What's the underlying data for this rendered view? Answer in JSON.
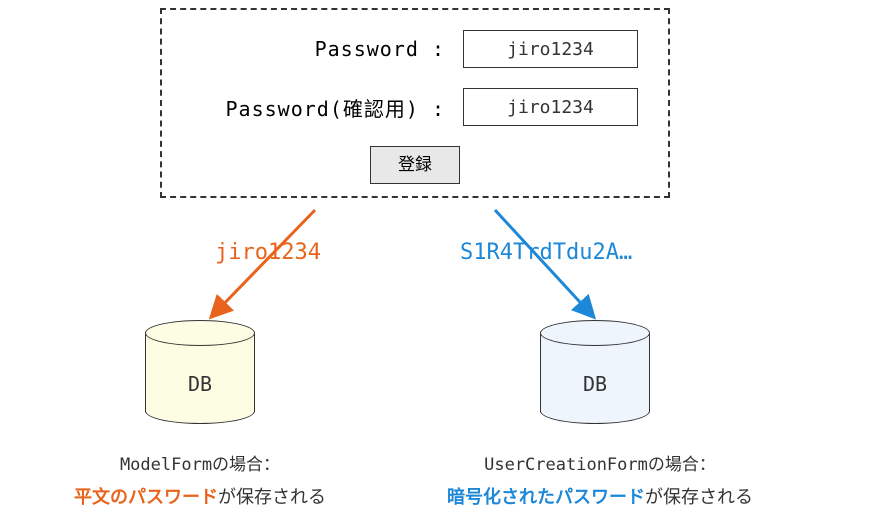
{
  "form": {
    "password_label": "Password :",
    "password_confirm_label": "Password(確認用) :",
    "password_value": "jiro1234",
    "password_confirm_value": "jiro1234",
    "submit_label": "登録"
  },
  "arrows": {
    "left_text": "jiro1234",
    "right_text": "S1R4TrdTdu2A…"
  },
  "db": {
    "left_label": "DB",
    "right_label": "DB"
  },
  "captions": {
    "left_title": "ModelFormの場合：",
    "left_highlight": "平文のパスワード",
    "left_rest": "が保存される",
    "right_title": "UserCreationFormの場合：",
    "right_highlight": "暗号化されたパスワード",
    "right_rest": "が保存される"
  },
  "colors": {
    "orange": "#e8641c",
    "blue": "#1e88d8"
  }
}
